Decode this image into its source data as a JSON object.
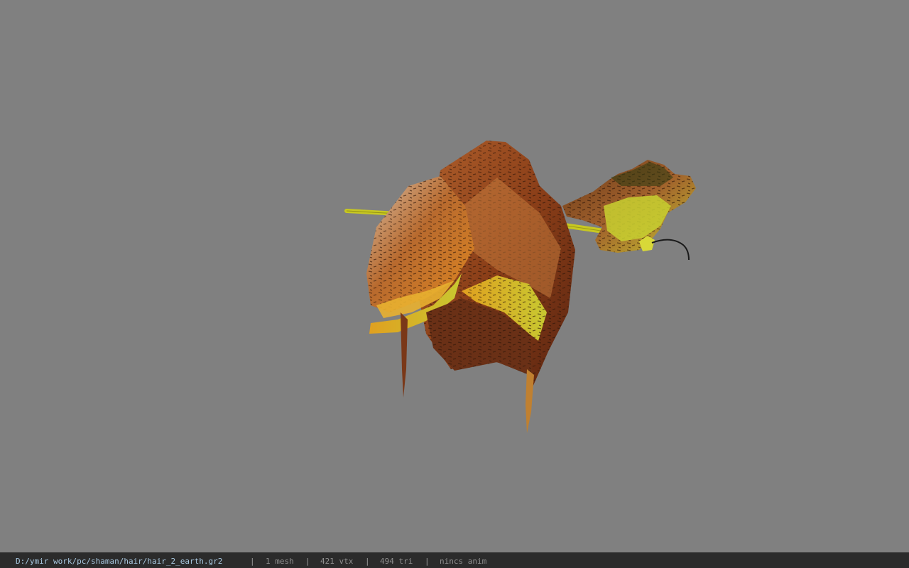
{
  "viewport": {
    "background_color": "#808080",
    "model": {
      "icon": "hair-mesh-preview",
      "colors": {
        "main_brown": "#a0522d",
        "dark_brown": "#5c2a10",
        "orange": "#d97a1e",
        "yellow_green": "#c8c830",
        "stick_yellow": "#c8c820"
      }
    }
  },
  "status_bar": {
    "file_path": "D:/ymir work/pc/shaman/hair/hair_2_earth.gr2",
    "separator": "|",
    "mesh_count": "1 mesh",
    "vertex_count": "421 vtx",
    "triangle_count": "494 tri",
    "animation": "nincs anim",
    "background_color": "#2b2b2b",
    "path_color": "#a8c8e0",
    "text_color": "#8f8f8f"
  }
}
